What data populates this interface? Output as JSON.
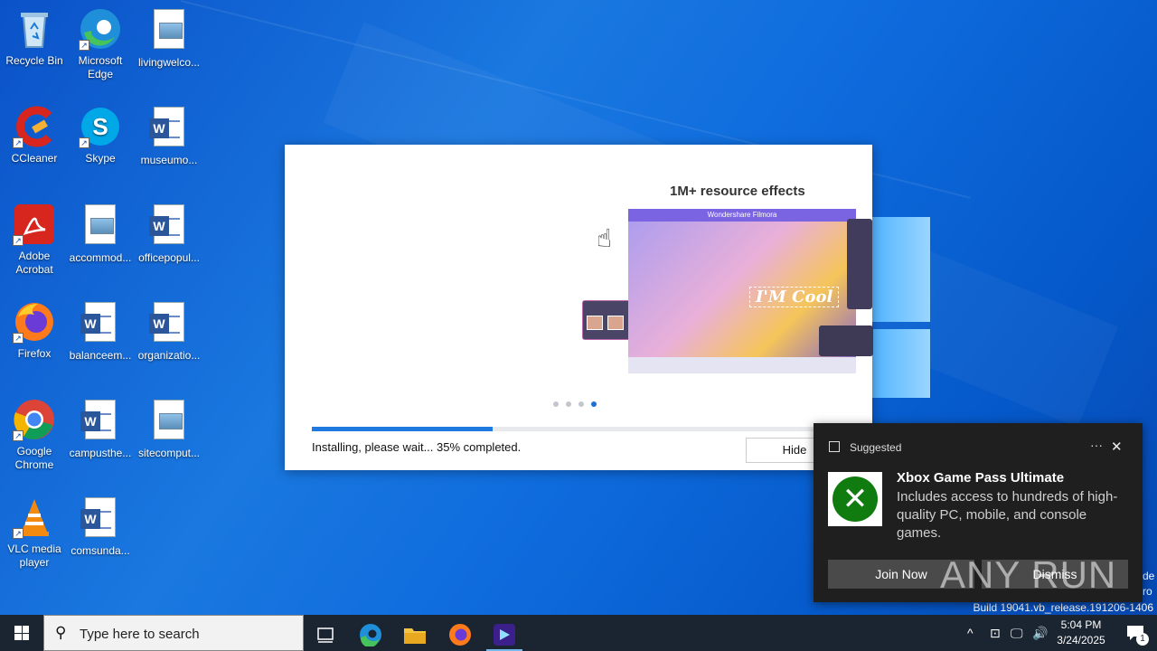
{
  "desktop": {
    "icons": [
      {
        "label": "Recycle Bin"
      },
      {
        "label": "Microsoft Edge"
      },
      {
        "label": "livingwelco..."
      },
      {
        "label": "CCleaner"
      },
      {
        "label": "Skype"
      },
      {
        "label": "museumo..."
      },
      {
        "label": "Adobe Acrobat"
      },
      {
        "label": "accommod..."
      },
      {
        "label": "officepopul..."
      },
      {
        "label": "Firefox"
      },
      {
        "label": "balanceem..."
      },
      {
        "label": "organizatio..."
      },
      {
        "label": "Google Chrome"
      },
      {
        "label": "campusthe..."
      },
      {
        "label": "sitecomput..."
      },
      {
        "label": "VLC media player"
      },
      {
        "label": "comsunda..."
      }
    ]
  },
  "installer": {
    "slide_heading": "1M+ resource effects",
    "preview_app_title": "Wondershare Filmora",
    "preview_overlay_text": "I'M Cool",
    "progress_percent": 35,
    "status_text": "Installing, please wait... 35% completed.",
    "hide_label": "Hide",
    "slide_count": 4,
    "active_slide": 4
  },
  "toast": {
    "header": "Suggested",
    "more_label": "···",
    "close_label": "✕",
    "title": "Xbox Game Pass Ultimate",
    "description": "Includes access to hundreds of high-quality PC, mobile, and console games.",
    "primary_button": "Join Now",
    "secondary_button": "Dismiss"
  },
  "watermark": {
    "build": "Build 19041.vb_release.191206-1406",
    "side_line_1": "de",
    "side_line_2": "ro",
    "brand_text": "ANY RUN"
  },
  "taskbar": {
    "search_placeholder": "Type here to search",
    "time": "5:04 PM",
    "date": "3/24/2025",
    "notification_count": "1",
    "pinned": [
      "task-view",
      "edge",
      "file-explorer",
      "firefox",
      "filmora-installer"
    ]
  }
}
